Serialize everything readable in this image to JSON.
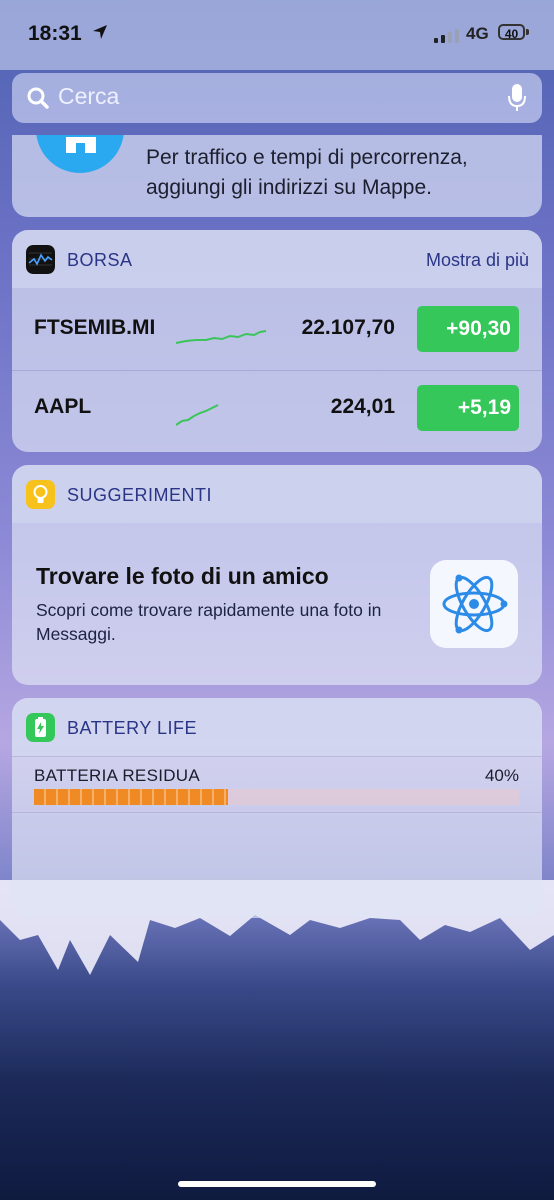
{
  "status": {
    "time": "18:31",
    "network": "4G",
    "battery": "40"
  },
  "search": {
    "placeholder": "Cerca"
  },
  "maps": {
    "message": "Per traffico e tempi di percorrenza, aggiungi gli indirizzi su Mappe."
  },
  "stocks": {
    "title": "BORSA",
    "more": "Mostra di più",
    "rows": [
      {
        "symbol": "FTSEMIB.MI",
        "price": "22.107,70",
        "change": "+90,30"
      },
      {
        "symbol": "AAPL",
        "price": "224,01",
        "change": "+5,19"
      }
    ],
    "positive_color": "#35c759"
  },
  "tips": {
    "title": "SUGGERIMENTI",
    "heading": "Trovare le foto di un amico",
    "body": "Scopri come trovare rapidamente una foto in Messaggi."
  },
  "battery_life": {
    "title": "BATTERY LIFE",
    "label": "BATTERIA RESIDUA",
    "percent_text": "40%",
    "level": 0.4
  }
}
